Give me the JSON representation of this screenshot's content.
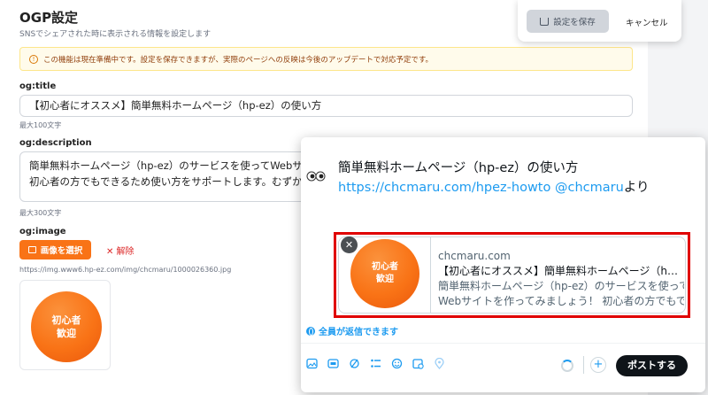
{
  "settings": {
    "title": "OGP設定",
    "subtitle": "SNSでシェアされた時に表示される情報を設定します",
    "notice": "この機能は現在準備中です。設定を保存できますが、実際のページへの反映は今後のアップデートで対応予定です。",
    "og_title": {
      "label": "og:title",
      "value": "【初心者にオススメ】簡単無料ホームページ（hp-ez）の使い方",
      "hint": "最大100文字"
    },
    "og_description": {
      "label": "og:description",
      "value_line1": "簡単無料ホームページ（hp-ez）のサービスを使ってWebサイトを作",
      "value_line2": "初心者の方でもできるため使い方をサポートします。むずかしい知",
      "hint": "最大300文字"
    },
    "og_image": {
      "label": "og:image",
      "select_button": "画像を選択",
      "remove_button": "✕ 解除",
      "url": "https://img.www6.hp-ez.com/img/chcmaru/1000026360.jpg",
      "image_text_line1": "初心者",
      "image_text_line2": "歓迎"
    }
  },
  "actions": {
    "save_label": "設定を保存",
    "cancel_label": "キャンセル"
  },
  "post": {
    "text_line1": "簡単無料ホームページ（hp-ez）の使い方",
    "link_url": "https://chcmaru.com/hpez-howto",
    "mention": "@chcmaru",
    "suffix": "より",
    "card": {
      "domain": "chcmaru.com",
      "title": "【初心者にオススメ】簡単無料ホームページ（hp-e...",
      "desc_line1": "簡単無料ホームページ（hp-ez）のサービスを使って",
      "desc_line2": "Webサイトを作ってみましょう！ 初心者の方でもで...",
      "image_text_line1": "初心者",
      "image_text_line2": "歓迎"
    },
    "reply_setting": "全員が返信できます",
    "post_button": "ポストする"
  },
  "colors": {
    "accent_orange": "#f97316",
    "x_blue": "#1d9bf0",
    "highlight_red": "#e00000"
  }
}
